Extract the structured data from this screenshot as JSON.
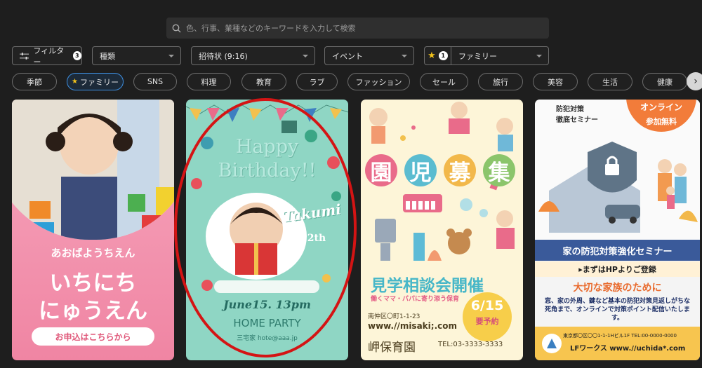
{
  "search": {
    "placeholder": "色、行事、業種などのキーワードを入力して検索"
  },
  "filters": {
    "filter_label": "フィルター",
    "filter_count": "3",
    "type_label": "種類",
    "format_label": "招待状 (9:16)",
    "event_label": "イベント",
    "fav_count": "1",
    "fav_label": "ファミリー"
  },
  "chips": [
    {
      "label": "季節"
    },
    {
      "label": "ファミリー",
      "active": true
    },
    {
      "label": "SNS"
    },
    {
      "label": "料理"
    },
    {
      "label": "教育"
    },
    {
      "label": "ラブ"
    },
    {
      "label": "ファッション"
    },
    {
      "label": "セール"
    },
    {
      "label": "旅行"
    },
    {
      "label": "美容"
    },
    {
      "label": "生活"
    },
    {
      "label": "健康"
    }
  ],
  "cards": {
    "c1": {
      "line1": "あおばようちえん",
      "line2": "いちにち",
      "line3": "にゅうえん",
      "cta": "お申込はこちらから"
    },
    "c2": {
      "title1": "Happy",
      "title2": "Birthday!!",
      "name": "Takumi",
      "age": "12th",
      "date": "June15. 13pm",
      "party": "HOME PARTY",
      "contact": "三宅家 hote@aaa.jp"
    },
    "c3": {
      "k1": "園",
      "k2": "児",
      "k3": "募",
      "k4": "集",
      "tour": "見学相談会開催",
      "sub": "働くママ・パパに寄り添う保育",
      "addr": "南仲区〇町1-1-23",
      "url": "www.//misaki;.com",
      "school": "岬保育園",
      "tel": "TEL:03-3333-3333",
      "date": "6/15",
      "reserve": "要予約"
    },
    "c4": {
      "lead1": "防犯対策",
      "lead2": "徹底セミナー",
      "online1": "オンライン",
      "online2": "参加無料",
      "band": "家の防犯対策強化セミナー",
      "hp": "▸まずはHPよりご登録",
      "family": "大切な家族のために",
      "body": "窓、家の外周、鍵など基本の防犯対策見返しがちな死角まで、オンラインで対策ポイント配信いたします。",
      "address": "東京都〇区〇〇1-1-1Hビル1F TEL:00-0000-0000",
      "company": "LFワークス www.//uchida*.com"
    }
  },
  "colors": {
    "accent_blue": "#3e8fe0",
    "highlight_ring": "#d41414",
    "star": "#f1c21b"
  }
}
